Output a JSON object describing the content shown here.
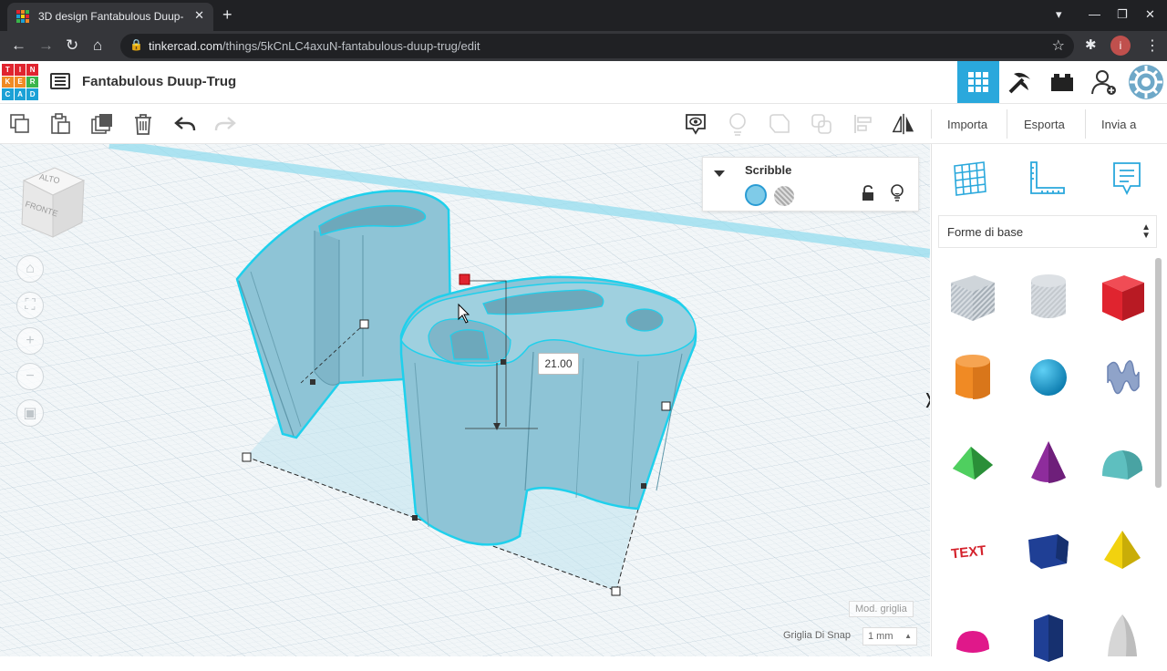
{
  "browser": {
    "tab_title": "3D design Fantabulous Duup-",
    "tab_close": "✕",
    "new_tab": "+",
    "url_domain": "tinkercad.com",
    "url_path": "/things/5kCnLC4axuN-fantabulous-duup-trug/edit",
    "win_controls": [
      "▾",
      "—",
      "❐",
      "✕"
    ]
  },
  "app": {
    "logo_letters": [
      "T",
      "I",
      "N",
      "K",
      "E",
      "R",
      "C",
      "A",
      "D"
    ],
    "design_title": "Fantabulous Duup-Trug"
  },
  "toolbar": {
    "import_label": "Importa",
    "export_label": "Esporta",
    "send_label": "Invia a"
  },
  "inspector": {
    "shape_name": "Scribble"
  },
  "workplane": {
    "view_cube_top": "ALTO",
    "view_cube_front": "FRONTE",
    "height_value": "21.00",
    "grid_edit_label": "Mod. griglia",
    "snap_label": "Griglia Di Snap",
    "snap_value": "1 mm",
    "panel_toggle": "❭"
  },
  "panel": {
    "category_selected": "Forme di base",
    "shapes": [
      {
        "name": "box-striped",
        "color": "#b5bdc5"
      },
      {
        "name": "cylinder-striped",
        "color": "#c4c9ce"
      },
      {
        "name": "box",
        "color": "#e0242f"
      },
      {
        "name": "cylinder",
        "color": "#f08a24"
      },
      {
        "name": "sphere",
        "color": "#1ba1d6"
      },
      {
        "name": "scribble",
        "color": "#8fa3c9"
      },
      {
        "name": "roof",
        "color": "#3ab54a"
      },
      {
        "name": "cone",
        "color": "#8e2c9c"
      },
      {
        "name": "round-roof",
        "color": "#5ebfbf"
      },
      {
        "name": "text",
        "color": "#d4222c"
      },
      {
        "name": "wedge",
        "color": "#1f3f95"
      },
      {
        "name": "pyramid",
        "color": "#f2d20f"
      },
      {
        "name": "half-sphere",
        "color": "#e0188a"
      },
      {
        "name": "polygon",
        "color": "#1f3f95"
      },
      {
        "name": "paraboloid",
        "color": "#d0d0d0"
      }
    ]
  },
  "colors": {
    "accent": "#2aa8dc",
    "shape_fill": "#8fc8da",
    "shape_outline": "#22c8e6"
  }
}
